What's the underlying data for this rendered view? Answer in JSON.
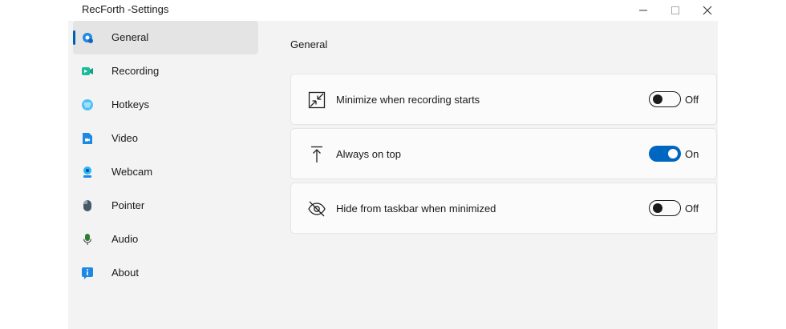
{
  "window": {
    "title": "RecForth -Settings"
  },
  "colors": {
    "accent": "#0067c0",
    "recording_icon": "#1abc9c",
    "nav_blue": "#1e88e5"
  },
  "sidebar": {
    "items": [
      {
        "label": "General",
        "icon": "gear-icon",
        "active": true
      },
      {
        "label": "Recording",
        "icon": "video-camera-icon",
        "active": false
      },
      {
        "label": "Hotkeys",
        "icon": "keyboard-icon",
        "active": false
      },
      {
        "label": "Video",
        "icon": "video-file-icon",
        "active": false
      },
      {
        "label": "Webcam",
        "icon": "webcam-icon",
        "active": false
      },
      {
        "label": "Pointer",
        "icon": "mouse-icon",
        "active": false
      },
      {
        "label": "Audio",
        "icon": "microphone-icon",
        "active": false
      },
      {
        "label": "About",
        "icon": "info-icon",
        "active": false
      }
    ]
  },
  "main": {
    "section_title": "General",
    "settings": [
      {
        "label": "Minimize when recording starts",
        "icon": "minimize-window-icon",
        "enabled": false,
        "state_text": "Off"
      },
      {
        "label": "Always on top",
        "icon": "pin-to-top-icon",
        "enabled": true,
        "state_text": "On"
      },
      {
        "label": "Hide from taskbar when minimized",
        "icon": "eye-off-icon",
        "enabled": false,
        "state_text": "Off"
      }
    ]
  }
}
